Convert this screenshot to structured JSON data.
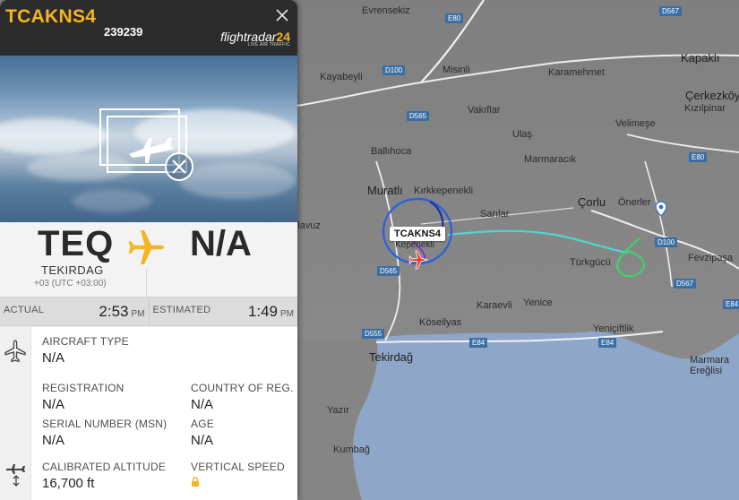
{
  "flight": {
    "callsign": "TCAKNS4",
    "flight_number": "239239",
    "origin_code": "TEQ",
    "origin_city": "TEKIRDAG",
    "origin_tz": "+03 (UTC +03:00)",
    "destination_code": "N/A"
  },
  "brand": {
    "name": "flightradar",
    "number": "24",
    "tagline": "LIVE AIR TRAFFIC"
  },
  "times": {
    "actual_label": "ACTUAL",
    "actual_value": "2:53",
    "actual_ampm": "PM",
    "estimated_label": "ESTIMATED",
    "estimated_value": "1:49",
    "estimated_ampm": "PM"
  },
  "details": {
    "aircraft_type_label": "AIRCRAFT TYPE",
    "aircraft_type_value": "N/A",
    "registration_label": "REGISTRATION",
    "registration_value": "N/A",
    "country_label": "COUNTRY OF REG.",
    "country_value": "N/A",
    "serial_label": "SERIAL NUMBER (MSN)",
    "serial_value": "N/A",
    "age_label": "AGE",
    "age_value": "N/A",
    "altitude_label": "CALIBRATED ALTITUDE",
    "altitude_value": "16,700 ft",
    "vspeed_label": "VERTICAL SPEED"
  },
  "icons": {
    "close": "close-icon",
    "no_photo": "no-photo-icon",
    "route_plane": "plane-icon",
    "aircraft": "aircraft-icon",
    "altitude": "altitude-icon",
    "lock": "lock-icon",
    "location": "location-pin-icon"
  },
  "colors": {
    "accent": "#f5b521",
    "header": "#2c2c2c",
    "sea": "#8ea7c8",
    "aircraft": "#e8433b",
    "track_blue": "#2d62d8",
    "track_cyan": "#4fd6d0",
    "track_green": "#38d86a"
  },
  "map": {
    "places": [
      "Evrensekiz",
      "Kayabeyli",
      "Misinli",
      "Karamehmet",
      "Kapaklı",
      "Çerkezköy",
      "Kızılpinar",
      "Velimeşe",
      "Vakıflar",
      "Ulaş",
      "Marmaracık",
      "Ballıhoca",
      "Muratlı",
      "Kırkkepenekli",
      "Sarılar",
      "Çorlu",
      "Önerler",
      "Kepenekli",
      "Türkgücü",
      "Fevzipaşa",
      "Karaevli",
      "Yenice",
      "Köseilyas",
      "Yeniçiftlik",
      "Tekirdağ",
      "Marmara Ereğlisi",
      "Yazır",
      "Kumbağ",
      "...ılavuz"
    ],
    "roads": [
      "E80",
      "D567",
      "D100",
      "D565",
      "E80",
      "D100",
      "D565",
      "D567",
      "D555",
      "E84",
      "E84",
      "E84"
    ]
  }
}
